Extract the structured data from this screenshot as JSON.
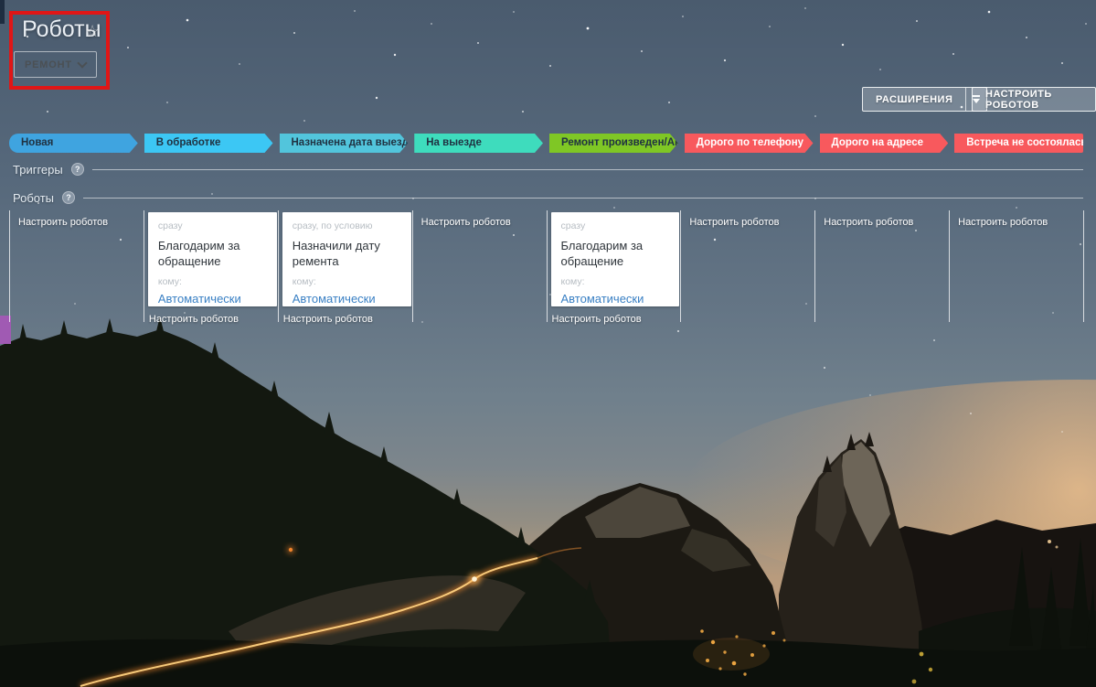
{
  "header": {
    "title": "Роботы",
    "favorite_icon": "☆",
    "funnel_button_label": "РЕМОНТ",
    "extensions_button_label": "РАСШИРЕНИЯ",
    "configure_robots_button_label": "НАСТРОИТЬ РОБОТОВ"
  },
  "pipeline": {
    "stages": [
      {
        "label": "Новая",
        "color": "#3fa4e0",
        "text_color": "#203242"
      },
      {
        "label": "В обработке",
        "color": "#3cc7f4",
        "text_color": "#203242"
      },
      {
        "label": "Назначена дата выезда",
        "color": "#52c5dc",
        "text_color": "#203242"
      },
      {
        "label": "На выезде",
        "color": "#3edcbd",
        "text_color": "#203242"
      },
      {
        "label": "Ремонт произведен/Акт",
        "color": "#7fc725",
        "text_color": "#203242"
      },
      {
        "label": "Дорого по телефону",
        "color": "#f8595d",
        "text_color": "#ffffff"
      },
      {
        "label": "Дорого на адресе",
        "color": "#f8595d",
        "text_color": "#ffffff"
      },
      {
        "label": "Встреча не состоялась",
        "color": "#f8595d",
        "text_color": "#ffffff"
      }
    ]
  },
  "sections": {
    "triggers_label": "Триггеры",
    "robots_label": "Роботы",
    "help_symbol": "?"
  },
  "board": {
    "configure_link_label": "Настроить роботов",
    "columns": [
      {
        "card": null
      },
      {
        "card": {
          "timing": "сразу",
          "title": "Благодарим за обращение",
          "recipient_label": "кому:",
          "recipient_value": "Автоматически"
        }
      },
      {
        "card": {
          "timing": "сразу, по условию",
          "title": "Назначили дату ремента",
          "recipient_label": "кому:",
          "recipient_value": "Автоматически"
        }
      },
      {
        "card": null
      },
      {
        "card": {
          "timing": "сразу",
          "title": "Благодарим за обращение",
          "recipient_label": "кому:",
          "recipient_value": "Автоматически"
        }
      },
      {
        "card": null
      },
      {
        "card": null
      },
      {
        "card": null
      }
    ]
  },
  "annotation": {
    "highlight_color": "#e01616"
  },
  "colors": {
    "purple_fragment": "#a05ab3",
    "link_blue": "#3a80c4",
    "card_muted_text": "#b7bdc3",
    "stage_text_dark": "#203242",
    "stage_text_light": "#ffffff"
  }
}
